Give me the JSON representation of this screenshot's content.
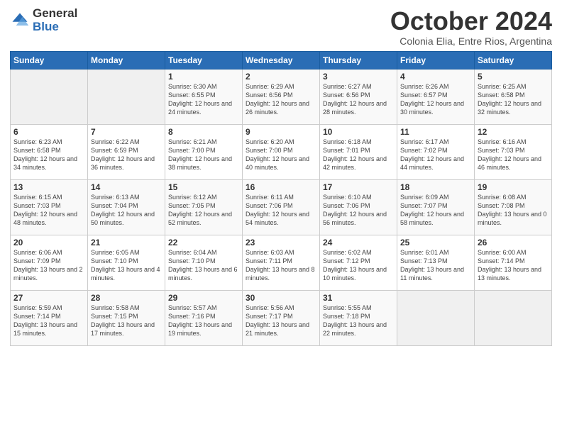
{
  "logo": {
    "general": "General",
    "blue": "Blue"
  },
  "title": "October 2024",
  "subtitle": "Colonia Elia, Entre Rios, Argentina",
  "days_of_week": [
    "Sunday",
    "Monday",
    "Tuesday",
    "Wednesday",
    "Thursday",
    "Friday",
    "Saturday"
  ],
  "weeks": [
    [
      {
        "day": "",
        "info": ""
      },
      {
        "day": "",
        "info": ""
      },
      {
        "day": "1",
        "info": "Sunrise: 6:30 AM\nSunset: 6:55 PM\nDaylight: 12 hours\nand 24 minutes."
      },
      {
        "day": "2",
        "info": "Sunrise: 6:29 AM\nSunset: 6:56 PM\nDaylight: 12 hours\nand 26 minutes."
      },
      {
        "day": "3",
        "info": "Sunrise: 6:27 AM\nSunset: 6:56 PM\nDaylight: 12 hours\nand 28 minutes."
      },
      {
        "day": "4",
        "info": "Sunrise: 6:26 AM\nSunset: 6:57 PM\nDaylight: 12 hours\nand 30 minutes."
      },
      {
        "day": "5",
        "info": "Sunrise: 6:25 AM\nSunset: 6:58 PM\nDaylight: 12 hours\nand 32 minutes."
      }
    ],
    [
      {
        "day": "6",
        "info": "Sunrise: 6:23 AM\nSunset: 6:58 PM\nDaylight: 12 hours\nand 34 minutes."
      },
      {
        "day": "7",
        "info": "Sunrise: 6:22 AM\nSunset: 6:59 PM\nDaylight: 12 hours\nand 36 minutes."
      },
      {
        "day": "8",
        "info": "Sunrise: 6:21 AM\nSunset: 7:00 PM\nDaylight: 12 hours\nand 38 minutes."
      },
      {
        "day": "9",
        "info": "Sunrise: 6:20 AM\nSunset: 7:00 PM\nDaylight: 12 hours\nand 40 minutes."
      },
      {
        "day": "10",
        "info": "Sunrise: 6:18 AM\nSunset: 7:01 PM\nDaylight: 12 hours\nand 42 minutes."
      },
      {
        "day": "11",
        "info": "Sunrise: 6:17 AM\nSunset: 7:02 PM\nDaylight: 12 hours\nand 44 minutes."
      },
      {
        "day": "12",
        "info": "Sunrise: 6:16 AM\nSunset: 7:03 PM\nDaylight: 12 hours\nand 46 minutes."
      }
    ],
    [
      {
        "day": "13",
        "info": "Sunrise: 6:15 AM\nSunset: 7:03 PM\nDaylight: 12 hours\nand 48 minutes."
      },
      {
        "day": "14",
        "info": "Sunrise: 6:13 AM\nSunset: 7:04 PM\nDaylight: 12 hours\nand 50 minutes."
      },
      {
        "day": "15",
        "info": "Sunrise: 6:12 AM\nSunset: 7:05 PM\nDaylight: 12 hours\nand 52 minutes."
      },
      {
        "day": "16",
        "info": "Sunrise: 6:11 AM\nSunset: 7:06 PM\nDaylight: 12 hours\nand 54 minutes."
      },
      {
        "day": "17",
        "info": "Sunrise: 6:10 AM\nSunset: 7:06 PM\nDaylight: 12 hours\nand 56 minutes."
      },
      {
        "day": "18",
        "info": "Sunrise: 6:09 AM\nSunset: 7:07 PM\nDaylight: 12 hours\nand 58 minutes."
      },
      {
        "day": "19",
        "info": "Sunrise: 6:08 AM\nSunset: 7:08 PM\nDaylight: 13 hours\nand 0 minutes."
      }
    ],
    [
      {
        "day": "20",
        "info": "Sunrise: 6:06 AM\nSunset: 7:09 PM\nDaylight: 13 hours\nand 2 minutes."
      },
      {
        "day": "21",
        "info": "Sunrise: 6:05 AM\nSunset: 7:10 PM\nDaylight: 13 hours\nand 4 minutes."
      },
      {
        "day": "22",
        "info": "Sunrise: 6:04 AM\nSunset: 7:10 PM\nDaylight: 13 hours\nand 6 minutes."
      },
      {
        "day": "23",
        "info": "Sunrise: 6:03 AM\nSunset: 7:11 PM\nDaylight: 13 hours\nand 8 minutes."
      },
      {
        "day": "24",
        "info": "Sunrise: 6:02 AM\nSunset: 7:12 PM\nDaylight: 13 hours\nand 10 minutes."
      },
      {
        "day": "25",
        "info": "Sunrise: 6:01 AM\nSunset: 7:13 PM\nDaylight: 13 hours\nand 11 minutes."
      },
      {
        "day": "26",
        "info": "Sunrise: 6:00 AM\nSunset: 7:14 PM\nDaylight: 13 hours\nand 13 minutes."
      }
    ],
    [
      {
        "day": "27",
        "info": "Sunrise: 5:59 AM\nSunset: 7:14 PM\nDaylight: 13 hours\nand 15 minutes."
      },
      {
        "day": "28",
        "info": "Sunrise: 5:58 AM\nSunset: 7:15 PM\nDaylight: 13 hours\nand 17 minutes."
      },
      {
        "day": "29",
        "info": "Sunrise: 5:57 AM\nSunset: 7:16 PM\nDaylight: 13 hours\nand 19 minutes."
      },
      {
        "day": "30",
        "info": "Sunrise: 5:56 AM\nSunset: 7:17 PM\nDaylight: 13 hours\nand 21 minutes."
      },
      {
        "day": "31",
        "info": "Sunrise: 5:55 AM\nSunset: 7:18 PM\nDaylight: 13 hours\nand 22 minutes."
      },
      {
        "day": "",
        "info": ""
      },
      {
        "day": "",
        "info": ""
      }
    ]
  ]
}
